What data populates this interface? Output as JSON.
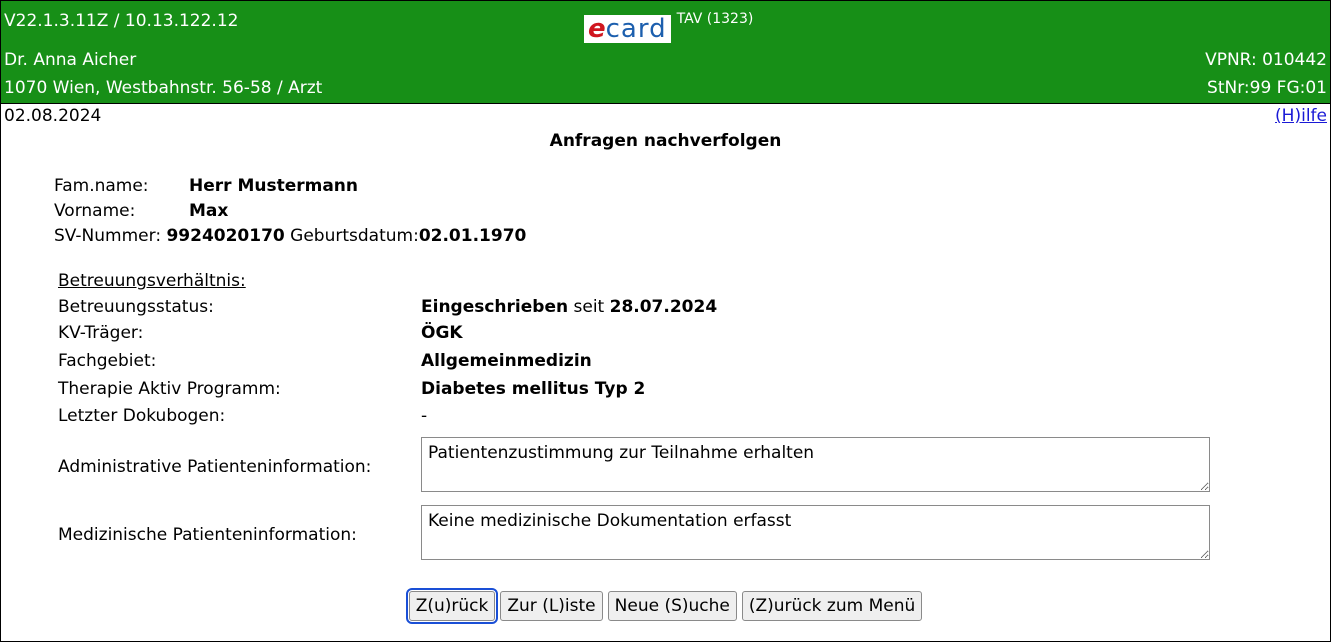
{
  "header": {
    "version": "V22.1.3.11Z / 10.13.122.12",
    "doctor": "Dr. Anna Aicher",
    "address": "1070 Wien, Westbahnstr. 56-58 / Arzt",
    "vpnr": "VPNR: 010442",
    "stnr": "StNr:99 FG:01",
    "logo_e": "e",
    "logo_card": "card",
    "logo_tav": "TAV (1323)",
    "brand_color": "#178f17"
  },
  "date": "02.08.2024",
  "help_link": "(H)ilfe",
  "page_title": "Anfragen nachverfolgen",
  "patient": {
    "famname_label": "Fam.name:",
    "famname_value": "Herr Mustermann",
    "vorname_label": "Vorname:",
    "vorname_value": "Max",
    "sv_label": "SV-Nummer:",
    "sv_value": "9924020170",
    "geb_label": "Geburtsdatum:",
    "geb_value": "02.01.1970"
  },
  "betreuung": {
    "heading": "Betreuungsverhältnis:",
    "status_label": "Betreuungsstatus:",
    "status_value": "Eingeschrieben",
    "status_seit": " seit ",
    "status_date": "28.07.2024",
    "kv_label": "KV-Träger:",
    "kv_value": "ÖGK",
    "fach_label": "Fachgebiet:",
    "fach_value": "Allgemeinmedizin",
    "programm_label": "Therapie Aktiv Programm:",
    "programm_value": "Diabetes mellitus Typ 2",
    "doku_label": "Letzter Dokubogen:",
    "doku_value": "-"
  },
  "admin_info": {
    "label": "Administrative Patienteninformation:",
    "value": "Patientenzustimmung zur Teilnahme erhalten"
  },
  "med_info": {
    "label": "Medizinische Patienteninformation:",
    "value": "Keine medizinische Dokumentation erfasst"
  },
  "buttons": {
    "back": "Z(u)rück",
    "list": "Zur (L)iste",
    "new_search": "Neue (S)uche",
    "menu": "(Z)urück zum Menü"
  }
}
